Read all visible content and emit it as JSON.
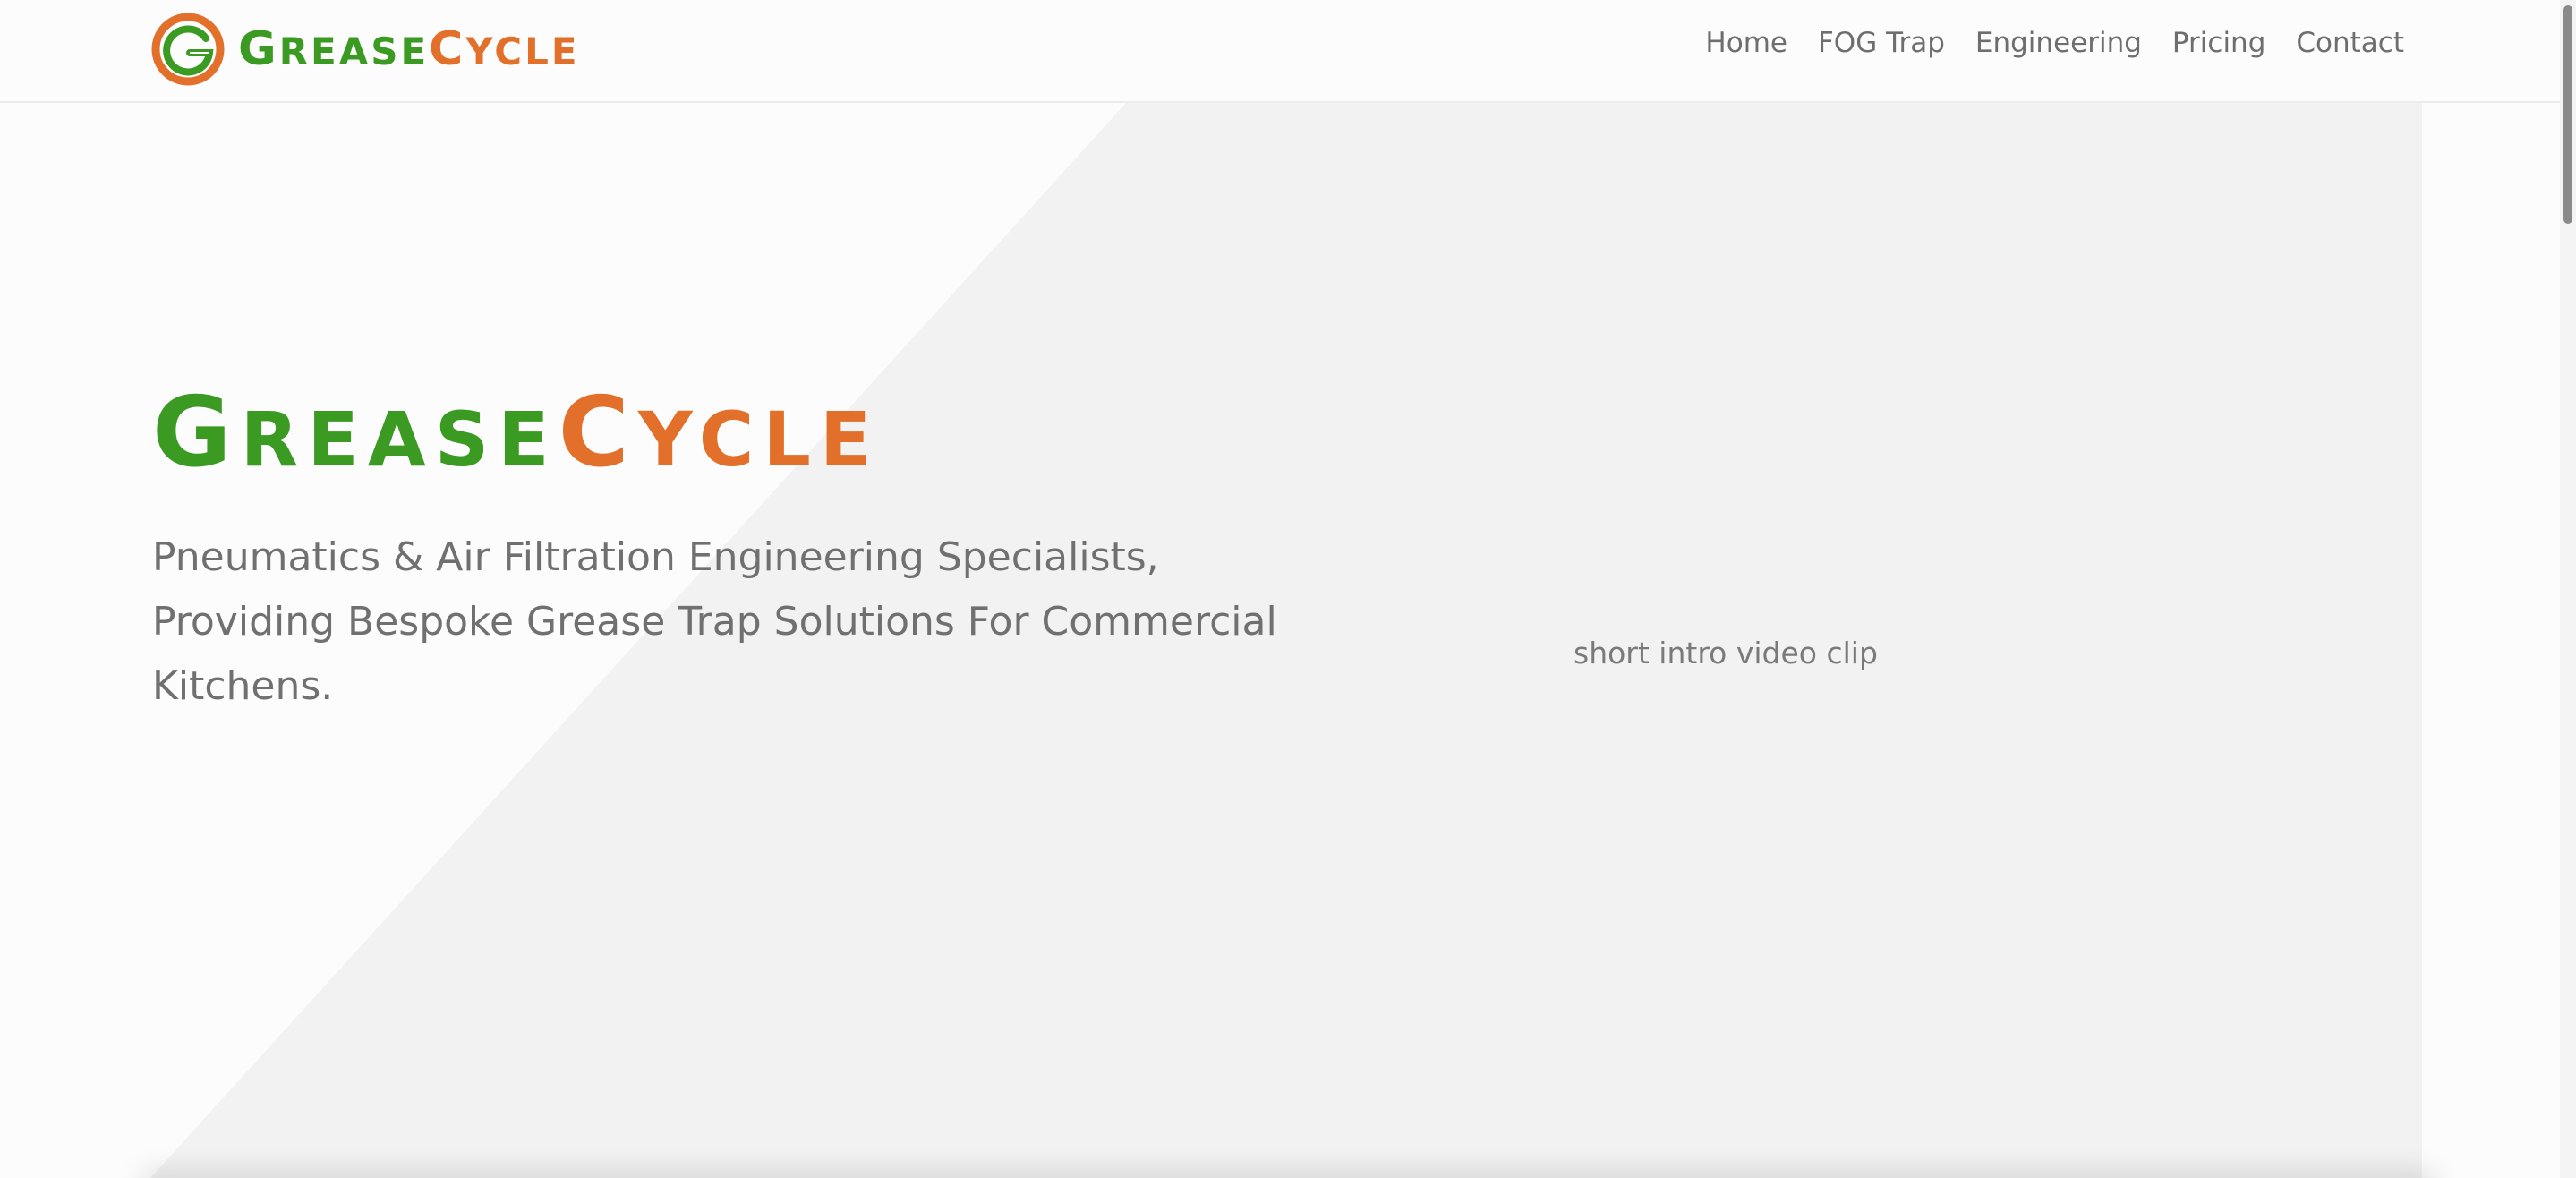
{
  "brand": {
    "logo_first_initial": "G",
    "logo_first_rest": "REASE",
    "logo_second_initial": "C",
    "logo_second_rest": "YCLE",
    "green": "#3a9a22",
    "orange": "#e2702a"
  },
  "nav": {
    "items": [
      {
        "label": "Home"
      },
      {
        "label": "FOG Trap"
      },
      {
        "label": "Engineering"
      },
      {
        "label": "Pricing"
      },
      {
        "label": "Contact"
      }
    ]
  },
  "hero": {
    "title_first_initial": "G",
    "title_first_rest": "REASE",
    "title_second_initial": "C",
    "title_second_rest": "YCLE",
    "subtitle": "Pneumatics & Air Filtration Engineering Specialists, Providing Bespoke Grease Trap Solutions For Commercial Kitchens.",
    "video_placeholder": "short intro video clip"
  }
}
